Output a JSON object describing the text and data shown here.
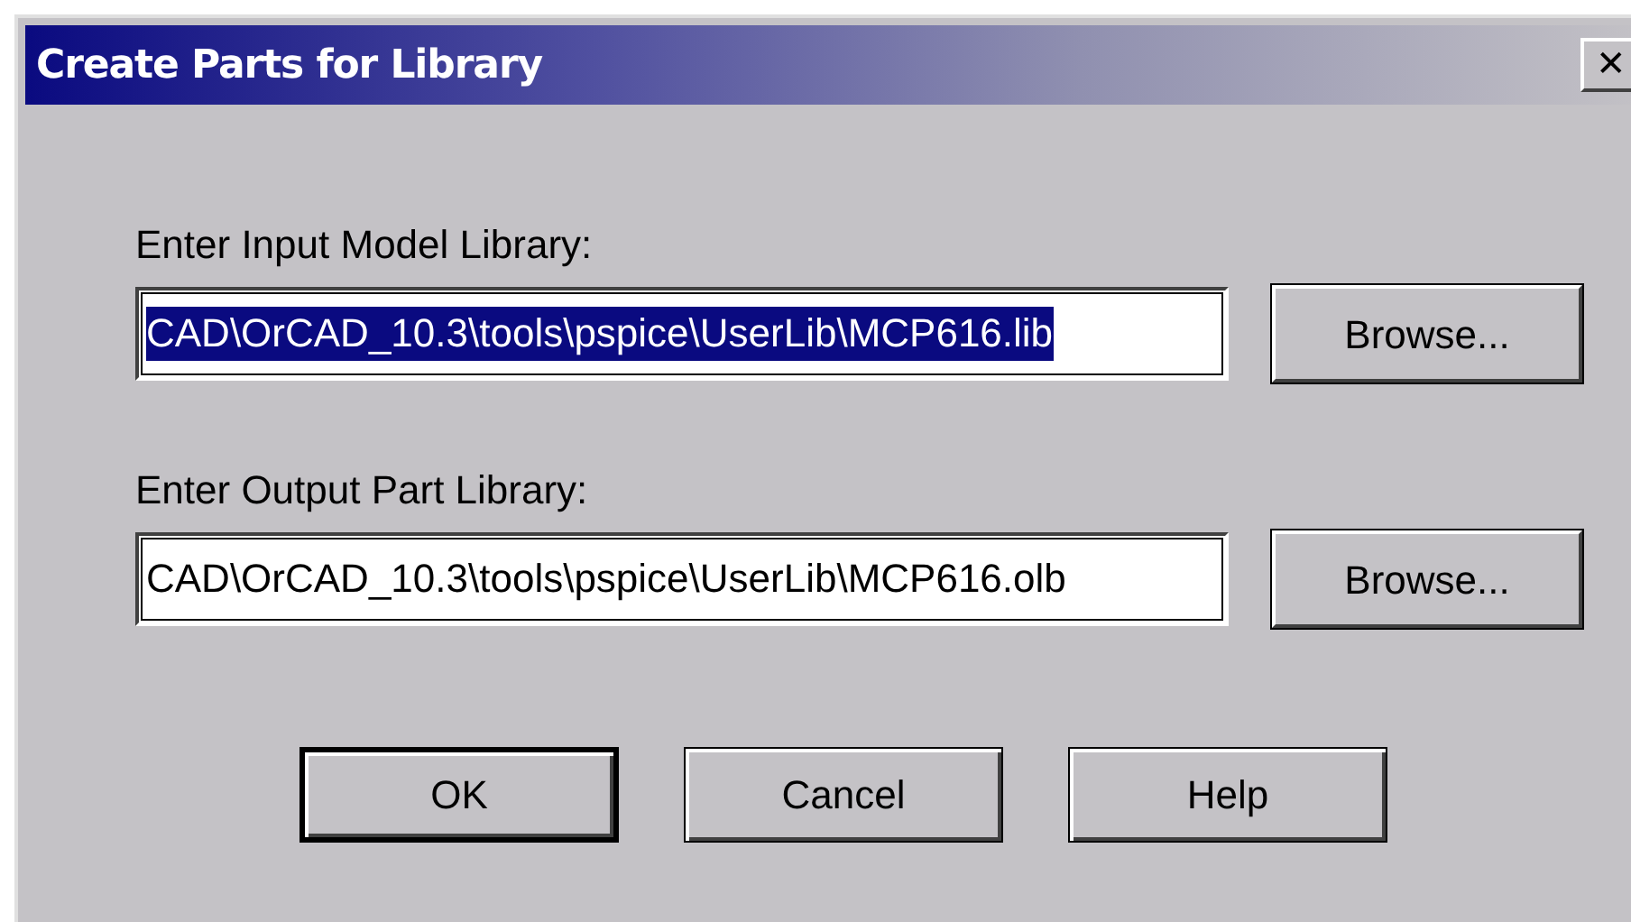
{
  "window": {
    "title": "Create Parts for Library",
    "close": "✕"
  },
  "fields": [
    {
      "label": "Enter Input Model Library:",
      "value": "CAD\\OrCAD_10.3\\tools\\pspice\\UserLib\\MCP616.lib",
      "text_selected": true,
      "button": "Browse..."
    },
    {
      "label": "Enter Output Part Library:",
      "value": "CAD\\OrCAD_10.3\\tools\\pspice\\UserLib\\MCP616.olb",
      "text_selected": false,
      "button": "Browse..."
    }
  ],
  "buttons": [
    {
      "label": "OK",
      "default": true
    },
    {
      "label": "Cancel",
      "default": false
    },
    {
      "label": "Help",
      "default": false
    }
  ]
}
